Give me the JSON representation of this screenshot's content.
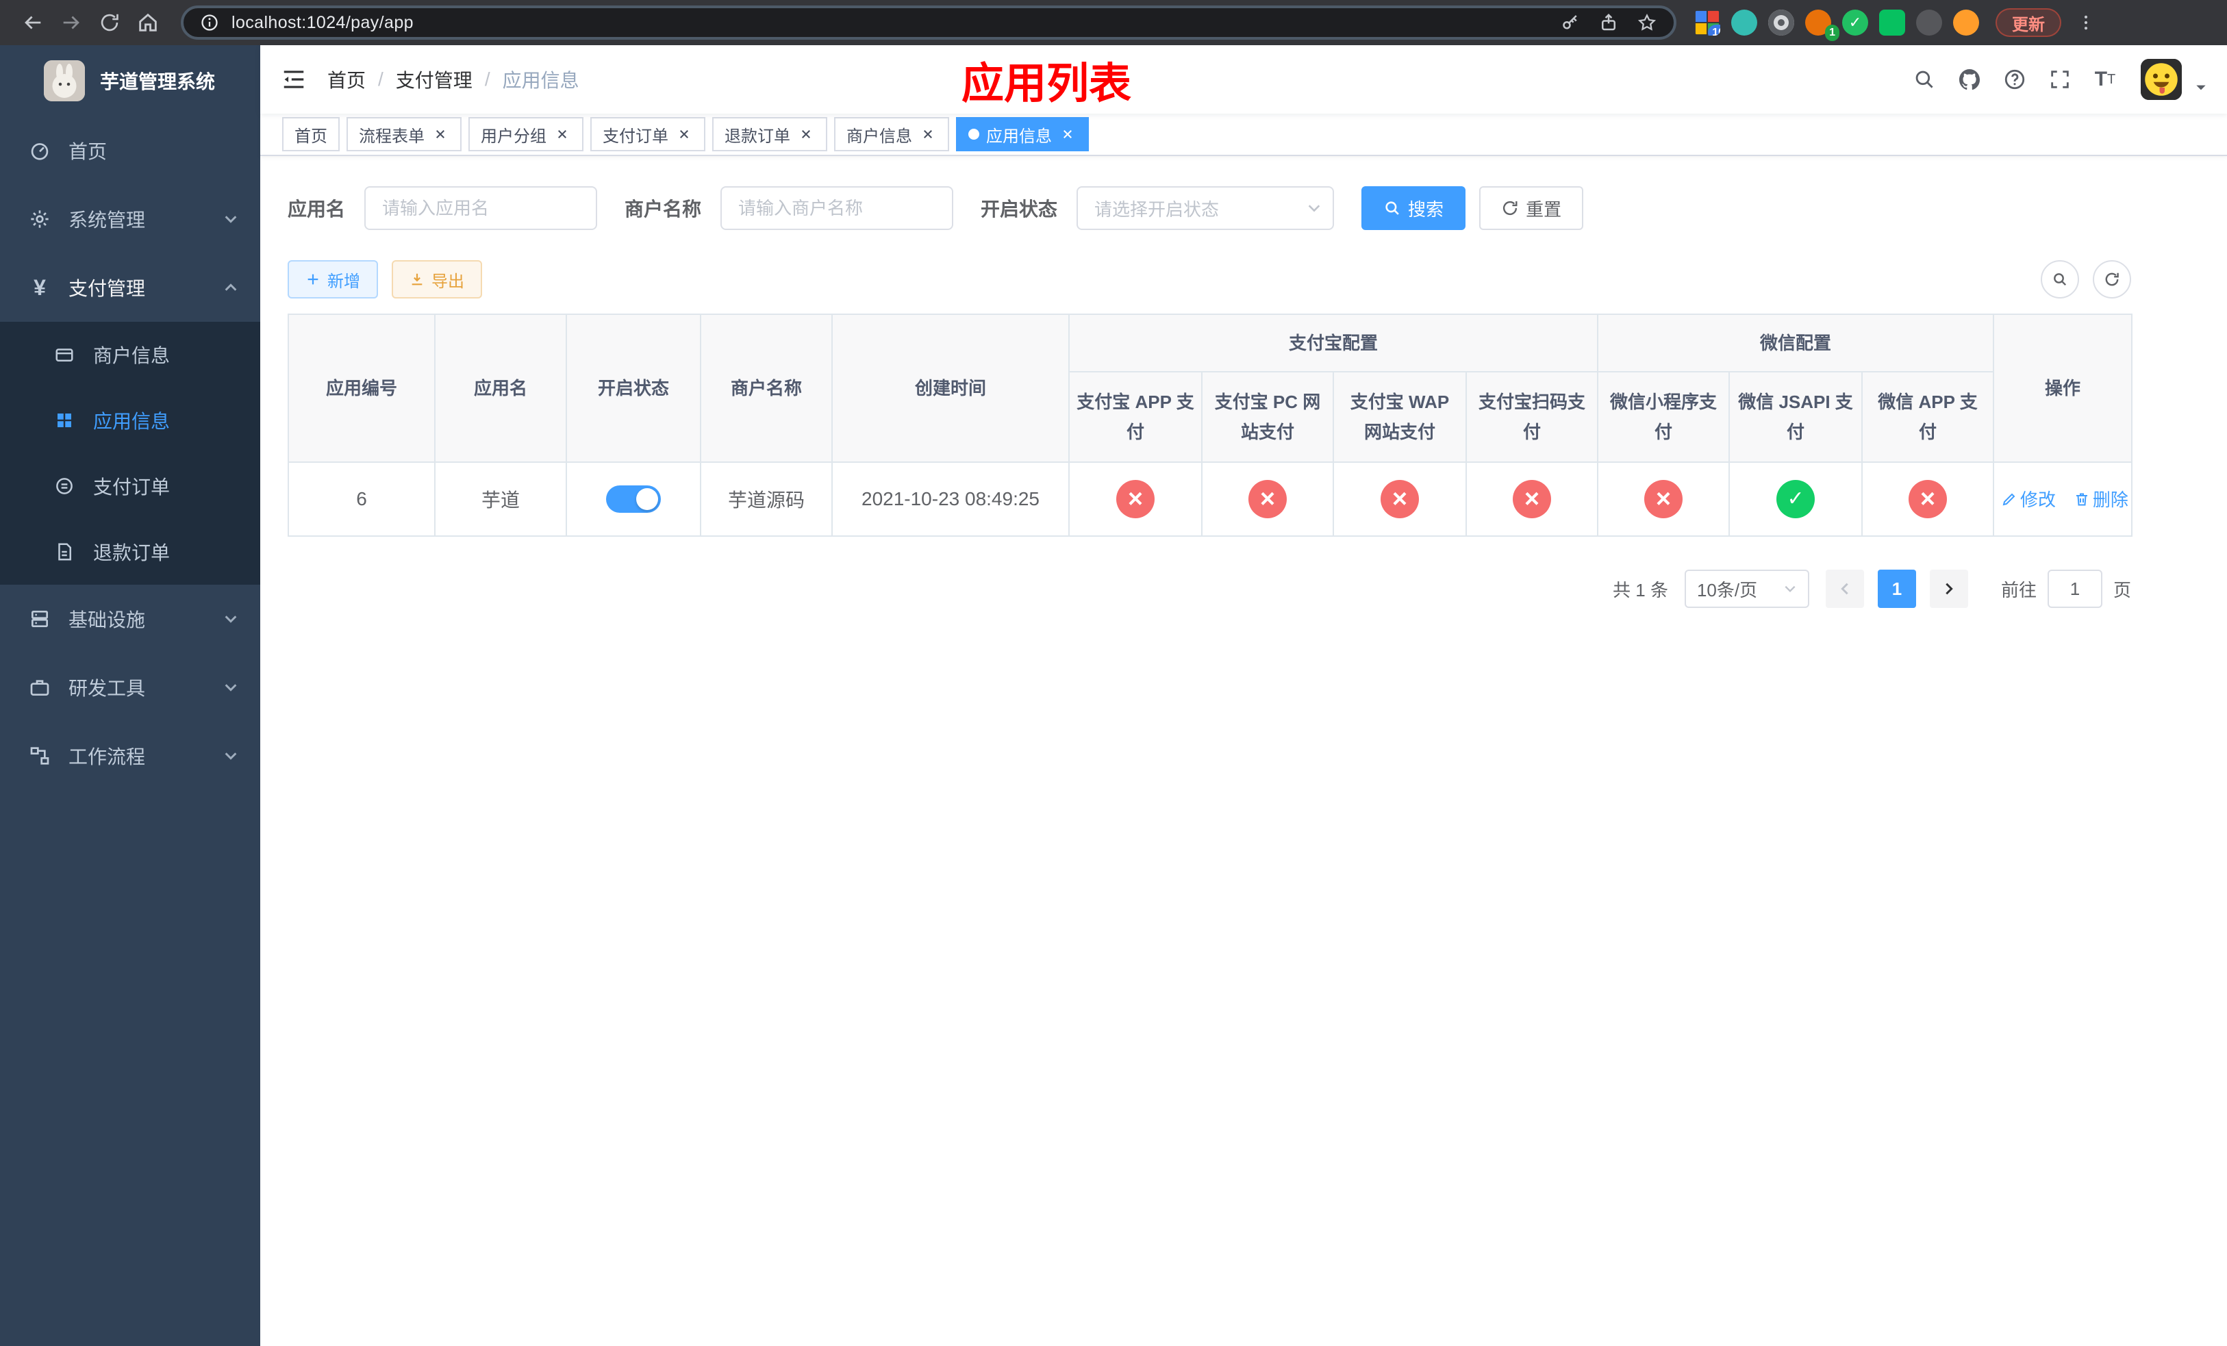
{
  "browser": {
    "url": "localhost:1024/pay/app",
    "update_button": "更新",
    "extension_badge_count": "10",
    "profile_badge_count": "1"
  },
  "sidebar": {
    "app_title": "芋道管理系统",
    "menu": [
      {
        "label": "首页"
      },
      {
        "label": "系统管理"
      },
      {
        "label": "支付管理"
      },
      {
        "label": "基础设施"
      },
      {
        "label": "研发工具"
      },
      {
        "label": "工作流程"
      }
    ],
    "pay_submenu": [
      {
        "label": "商户信息"
      },
      {
        "label": "应用信息"
      },
      {
        "label": "支付订单"
      },
      {
        "label": "退款订单"
      }
    ]
  },
  "header": {
    "breadcrumb": [
      "首页",
      "支付管理",
      "应用信息"
    ],
    "page_title": "应用列表"
  },
  "tabs": [
    {
      "label": "首页"
    },
    {
      "label": "流程表单"
    },
    {
      "label": "用户分组"
    },
    {
      "label": "支付订单"
    },
    {
      "label": "退款订单"
    },
    {
      "label": "商户信息"
    },
    {
      "label": "应用信息"
    }
  ],
  "filter": {
    "app_name_label": "应用名",
    "app_name_placeholder": "请输入应用名",
    "merchant_label": "商户名称",
    "merchant_placeholder": "请输入商户名称",
    "status_label": "开启状态",
    "status_placeholder": "请选择开启状态",
    "search_button": "搜索",
    "reset_button": "重置"
  },
  "toolbar": {
    "add_button": "新增",
    "export_button": "导出"
  },
  "table": {
    "columns": {
      "id": "应用编号",
      "name": "应用名",
      "status": "开启状态",
      "merchant": "商户名称",
      "created": "创建时间",
      "alipay_group": "支付宝配置",
      "alipay_app": "支付宝 APP 支付",
      "alipay_pc": "支付宝 PC 网站支付",
      "alipay_wap": "支付宝 WAP 网站支付",
      "alipay_qr": "支付宝扫码支付",
      "wechat_group": "微信配置",
      "wechat_mini": "微信小程序支付",
      "wechat_jsapi": "微信 JSAPI 支付",
      "wechat_app": "微信 APP 支付",
      "actions": "操作"
    },
    "rows": [
      {
        "id": "6",
        "name": "芋道",
        "enabled": "on",
        "merchant": "芋道源码",
        "created": "2021-10-23 08:49:25",
        "alipay_app": "no",
        "alipay_pc": "no",
        "alipay_wap": "no",
        "alipay_qr": "no",
        "wechat_mini": "no",
        "wechat_jsapi": "yes",
        "wechat_app": "no",
        "edit_label": "修改",
        "delete_label": "删除"
      }
    ]
  },
  "pagination": {
    "total_text": "共 1 条",
    "page_size": "10条/页",
    "current_page": "1",
    "jump_prefix": "前往",
    "jump_value": "1",
    "jump_suffix": "页"
  },
  "colors": {
    "primary": "#409eff",
    "danger": "#f56c6c",
    "success": "#13ce66",
    "title_red": "#ff0000",
    "sidebar_bg": "#304156",
    "submenu_bg": "#1f2d3d"
  }
}
